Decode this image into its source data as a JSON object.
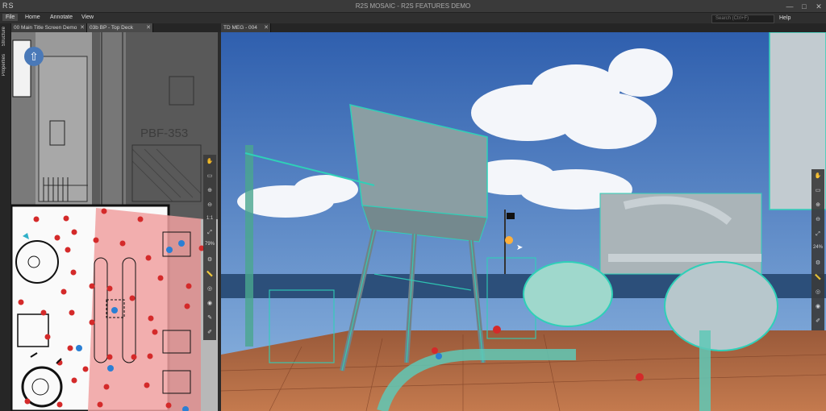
{
  "app": {
    "logo_text": "RS",
    "window_title": "R2S MOSAIC - R2S FEATURES DEMO",
    "controls": {
      "minimize": "—",
      "maximize": "□",
      "close": "✕"
    }
  },
  "menubar": {
    "items": [
      "File",
      "Home",
      "Annotate",
      "View"
    ],
    "search_placeholder": "Search (Ctrl+F)",
    "help_label": "Help"
  },
  "tabs": {
    "left": [
      {
        "label": "00 Main Title Screen Demo",
        "close": "✕"
      },
      {
        "label": "03b BP - Top Deck",
        "close": "✕"
      }
    ],
    "right": [
      {
        "label": "TD MEG - 004",
        "close": "✕"
      }
    ]
  },
  "side_panel": {
    "labels": [
      "Structure",
      "Properties"
    ]
  },
  "floorplan": {
    "room_label": "PBF-353",
    "zoom_label": "79%",
    "scale_label": "1:1"
  },
  "viewer": {
    "zoom_label": "24%"
  },
  "icons": {
    "nav_arrow": "up-arrow-icon",
    "cursor": "pointer-cursor-icon",
    "tools": [
      "hand-icon",
      "rectangle-select-icon",
      "zoom-in-icon",
      "zoom-out-icon",
      "fit-icon",
      "measure-icon",
      "pen-icon",
      "settings-icon",
      "layers-icon",
      "pin-icon",
      "edit-icon"
    ]
  },
  "colors": {
    "accent_teal": "#2fd0b8",
    "marker_red": "#d42a2a",
    "marker_blue": "#2a7fd4",
    "zone_pink": "#f0a0a0"
  }
}
